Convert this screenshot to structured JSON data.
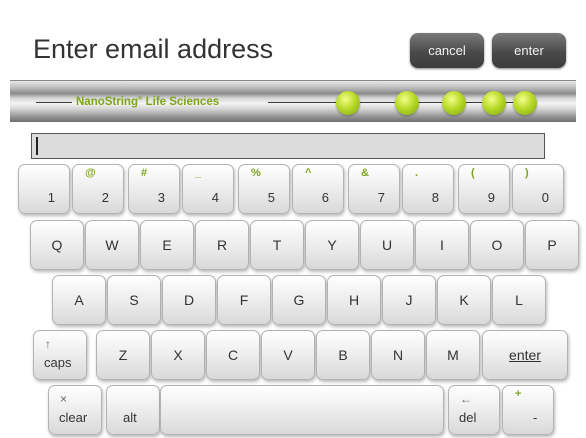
{
  "header": {
    "title": "Enter email address",
    "cancel_label": "cancel",
    "enter_label": "enter"
  },
  "brand": {
    "name": "NanoString",
    "registered": "®",
    "suffix": " Life Sciences",
    "accent_color": "#7fa41a"
  },
  "email_field": {
    "value": ""
  },
  "keyboard": {
    "numbers": [
      {
        "main": "1",
        "sub": ""
      },
      {
        "main": "2",
        "sub": "@"
      },
      {
        "main": "3",
        "sub": "#"
      },
      {
        "main": "4",
        "sub": "_"
      },
      {
        "main": "5",
        "sub": "%"
      },
      {
        "main": "6",
        "sub": "^"
      },
      {
        "main": "7",
        "sub": "&"
      },
      {
        "main": "8",
        "sub": "."
      },
      {
        "main": "9",
        "sub": "("
      },
      {
        "main": "0",
        "sub": ")"
      }
    ],
    "row_q": [
      "Q",
      "W",
      "E",
      "R",
      "T",
      "Y",
      "U",
      "I",
      "O",
      "P"
    ],
    "row_a": [
      "A",
      "S",
      "D",
      "F",
      "G",
      "H",
      "J",
      "K",
      "L"
    ],
    "row_z": [
      "Z",
      "X",
      "C",
      "V",
      "B",
      "N",
      "M"
    ],
    "caps_label": "caps",
    "caps_icon": "↑",
    "enter_label": "enter",
    "clear_label": "clear",
    "clear_icon": "×",
    "alt_label": "alt",
    "del_label": "del",
    "del_icon": "←",
    "minus_label": "-",
    "plus_label": "+"
  }
}
